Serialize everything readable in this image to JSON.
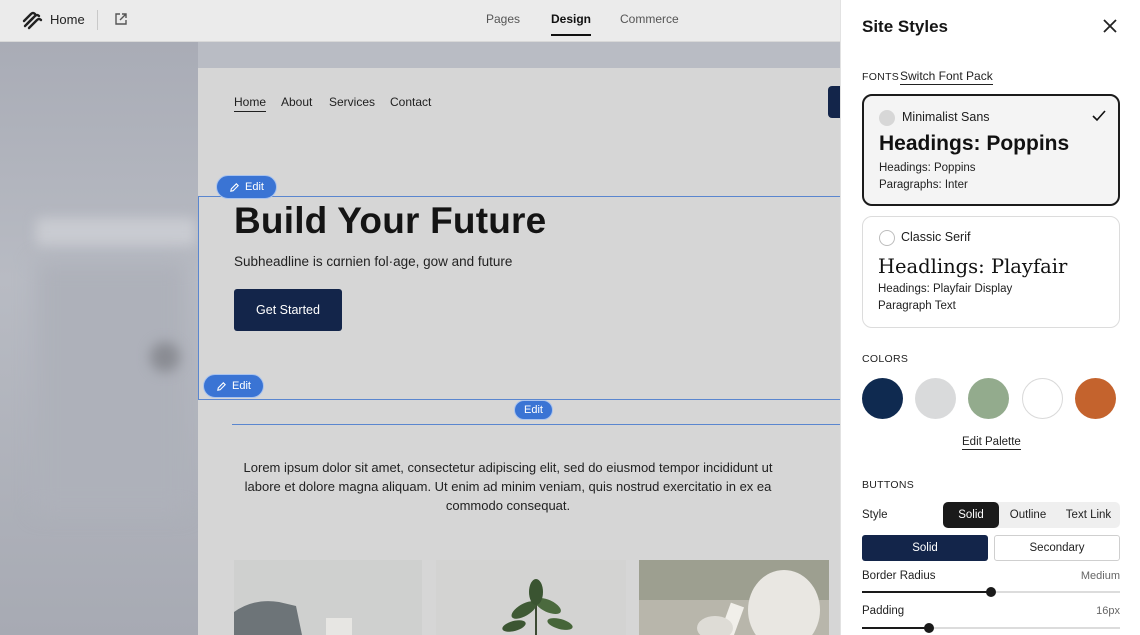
{
  "topbar": {
    "home_label": "Home",
    "tabs": [
      "Pages",
      "Design",
      "Commerce"
    ],
    "active_tab": "Design"
  },
  "site": {
    "nav": [
      "Home",
      "About",
      "Services",
      "Contact"
    ],
    "active_nav": "Home",
    "edit_label": "Edit",
    "hero_title": "Build Your Future",
    "hero_subtitle": "Subheadline is cɑrnien fol·age, gow and future",
    "hero_button": "Get Started",
    "body_text": "Lorem ipsum dolor sit amet, consectetur adipiscing elit, sed do eiusmod tempor incididunt ut labore et dolore magna aliquam. Ut enim ad minim veniam, quis nostrud exercitatio in ex ea commodo consequat."
  },
  "panel": {
    "title": "Site Styles",
    "fonts_label": "FONTS",
    "switch_font_pack": "Switch Font Pack",
    "font_packs": [
      {
        "name": "Minimalist Sans",
        "heading": "Headings: Poppins",
        "line1": "Headings: Poppins",
        "line2": "Paragraphs: Inter",
        "selected": true
      },
      {
        "name": "Classic Serif",
        "heading": "Headlings: Playfair",
        "line1": "Headings: Playfair Display",
        "line2": "Paragraph Text",
        "selected": false
      }
    ],
    "colors_label": "COLORS",
    "colors": [
      "#0f2a50",
      "#d9dadb",
      "#93ab8d",
      "#ffffff",
      "#c4632d"
    ],
    "edit_palette": "Edit Palette",
    "buttons_label": "BUTTONS",
    "style_label": "Style",
    "style_options": [
      "Solid",
      "Outline",
      "Text Link"
    ],
    "active_style": "Solid",
    "variants": [
      "Solid",
      "Secondary"
    ],
    "border_radius_label": "Border Radius",
    "border_radius_value": "Medium",
    "border_radius_level": 0.5,
    "padding_label": "Padding",
    "padding_value": "16px",
    "padding_level": 0.26
  },
  "icons": {
    "logo": "squarespace-logo-icon",
    "external": "external-link-icon",
    "close": "close-icon",
    "check": "check-icon",
    "pencil": "pencil-icon"
  }
}
